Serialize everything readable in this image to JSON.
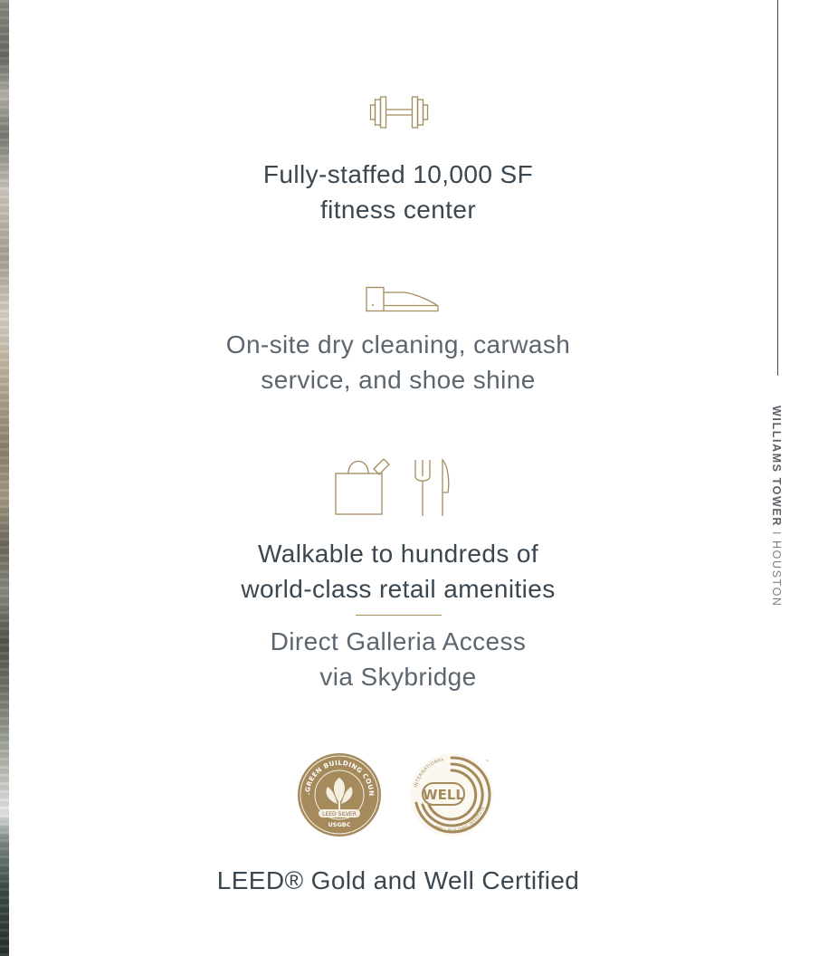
{
  "colors": {
    "gold": "#a58a5c",
    "text": "#3a4650",
    "rule": "#4a4f55"
  },
  "side_label": {
    "brand": "WILLIAMS TOWER",
    "separator": "I",
    "city": "HOUSTON"
  },
  "features": [
    {
      "icon": "dumbbell-icon",
      "lines": [
        "Fully-staffed 10,000 SF",
        "fitness center"
      ]
    },
    {
      "icon": "shoe-icon",
      "lines": [
        "On-site dry cleaning, carwash",
        "service, and shoe shine"
      ]
    },
    {
      "icon": "shopping-dining-icon",
      "lines": [
        "Walkable to hundreds of",
        "world-class retail amenities"
      ]
    },
    {
      "icon": "",
      "lines": [
        "Direct Galleria Access",
        "via Skybridge"
      ]
    }
  ],
  "badges": {
    "leed": {
      "arc_text": "U.S.GREEN BUILDING COUNCIL",
      "level": "LEED SILVER",
      "org": "USGBC"
    },
    "well": {
      "label": "WELL",
      "arc_top": "INTERNATIONAL",
      "arc_bottom": "WELL BUILDING INSTITUTE",
      "tm": "™"
    }
  },
  "certification": {
    "text": "LEED® Gold and Well Certified"
  }
}
